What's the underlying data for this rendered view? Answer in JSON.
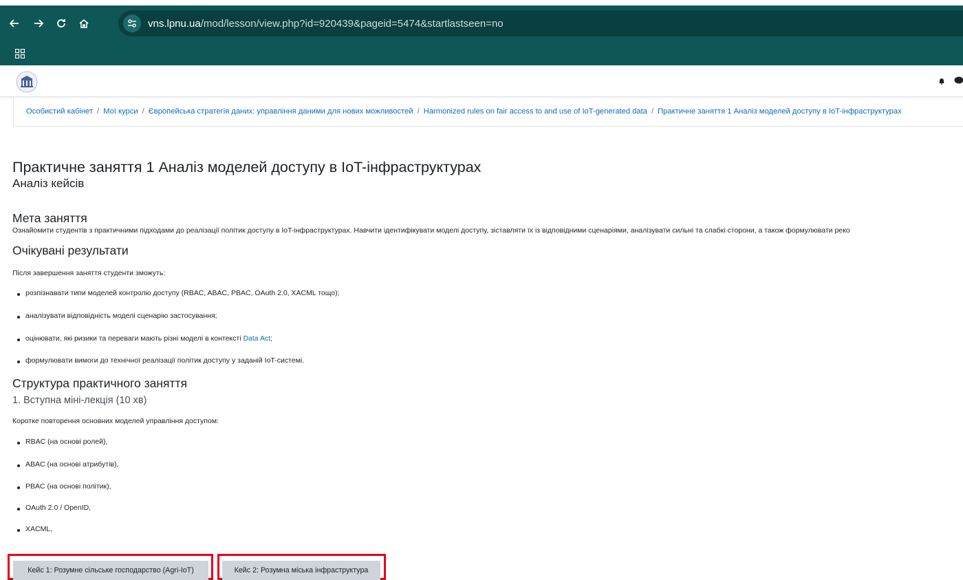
{
  "browser": {
    "url_host": "vns.lpnu.ua",
    "url_path": "/mod/lesson/view.php?id=920439&pageid=5474&startlastseen=no"
  },
  "breadcrumb": [
    "Особистий кабінет",
    "Мої курси",
    "Європейська стратегія даних: управління даними для нових можливостей",
    "Harmonized rules on fair access to and use of IoT-generated data",
    "Практичне заняття 1 Аналіз моделей доступу в IoT-інфраструктурах"
  ],
  "page": {
    "title": "Практичне заняття 1 Аналіз моделей доступу в IoT-інфраструктурах",
    "subtitle": "Аналіз кейсів",
    "goal_heading": "Мета заняття",
    "goal_text": "Ознайомити студентів з практичними підходами до реалізації політик доступу в IoT-інфраструктурах. Навчити ідентифікувати моделі доступу, зіставляти їх із відповідними сценаріями, аналізувати сильні та слабкі сторони, а також формулювати реко",
    "results_heading": "Очікувані результати",
    "results_intro": "Після завершення заняття студенти зможуть:",
    "results": [
      "розпізнавати типи моделей контролю доступу (RBAC, ABAC, PBAC, OAuth 2.0, XACML тощо);",
      "аналізувати відповідність моделі сценарію застосування;",
      "оцінювати, які ризики та переваги мають різні моделі в контексті ",
      "формулювати вимоги до технічної реалізації політик доступу у заданій IoT-системі."
    ],
    "data_act_link": "Data Act",
    "data_act_suffix": ";",
    "structure_heading": "Структура практичного заняття",
    "intro_heading": "1. Вступна міні-лекція (10 хв)",
    "intro_text": "Коротке повторення основних моделей управління доступом:",
    "models": [
      "RBAC (на основі ролей),",
      "ABAC (на основі атрибутів),",
      "PBAC (на основі політик),",
      "OAuth 2.0 / OpenID,",
      "XACML,"
    ]
  },
  "buttons": {
    "case1": "Кейс 1: Розумне сільське господарство (Agri-IoT)",
    "case2": "Кейс 2: Розумна міська інфраструктура"
  },
  "colors": {
    "browser_bar": "#0f5756",
    "link": "#0f6cbf",
    "highlight": "#e4001b",
    "button_bg": "#ced4da"
  }
}
